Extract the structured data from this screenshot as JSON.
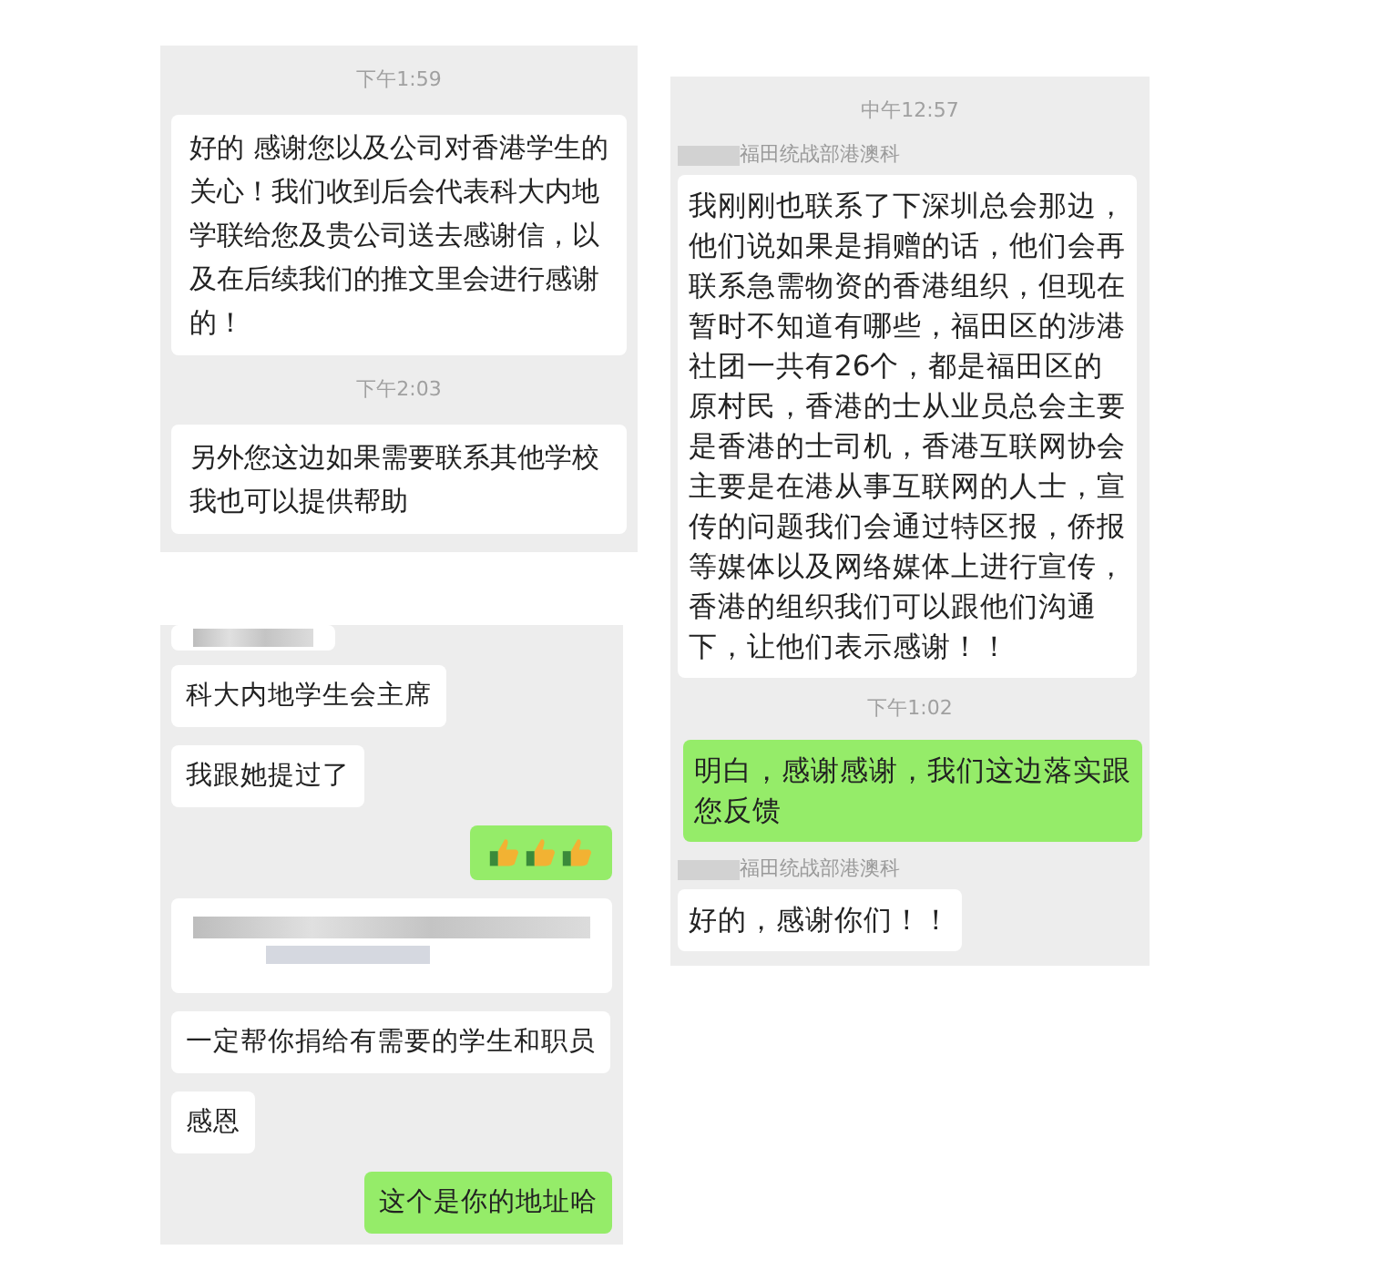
{
  "panels": [
    {
      "messages": [
        {
          "kind": "time",
          "text": "下午1:59"
        },
        {
          "kind": "incoming",
          "text": "好的 感谢您以及公司对香港学生的关心！我们收到后会代表科大内地学联给您及贵公司送去感谢信，以及在后续我们的推文里会进行感谢的！"
        },
        {
          "kind": "time",
          "text": "下午2:03"
        },
        {
          "kind": "incoming",
          "text": "另外您这边如果需要联系其他学校我也可以提供帮助"
        }
      ]
    },
    {
      "messages": [
        {
          "kind": "redacted_cut"
        },
        {
          "kind": "incoming",
          "text": "科大内地学生会主席"
        },
        {
          "kind": "incoming",
          "text": "我跟她提过了"
        },
        {
          "kind": "thumbs"
        },
        {
          "kind": "redacted"
        },
        {
          "kind": "incoming",
          "text": "一定帮你捐给有需要的学生和职员"
        },
        {
          "kind": "incoming",
          "text": "感恩"
        },
        {
          "kind": "outgoing",
          "text": "这个是你的地址哈"
        }
      ]
    },
    {
      "messages": [
        {
          "kind": "time",
          "text": "中午12:57"
        },
        {
          "kind": "sender",
          "text": "福田统战部港澳科"
        },
        {
          "kind": "incoming",
          "text": "我刚刚也联系了下深圳总会那边，他们说如果是捐赠的话，他们会再联系急需物资的香港组织，但现在暂时不知道有哪些，福田区的涉港社团一共有26个，都是福田区的原村民，香港的士从业员总会主要是香港的士司机，香港互联网协会主要是在港从事互联网的人士，宣传的问题我们会通过特区报，侨报等媒体以及网络媒体上进行宣传，香港的组织我们可以跟他们沟通下，让他们表示感谢！！"
        },
        {
          "kind": "time",
          "text": "下午1:02"
        },
        {
          "kind": "outgoing",
          "text": "明白，感谢感谢，我们这边落实跟您反馈"
        },
        {
          "kind": "sender",
          "text": "福田统战部港澳科"
        },
        {
          "kind": "incoming",
          "text": "好的，感谢你们！！"
        }
      ]
    }
  ]
}
